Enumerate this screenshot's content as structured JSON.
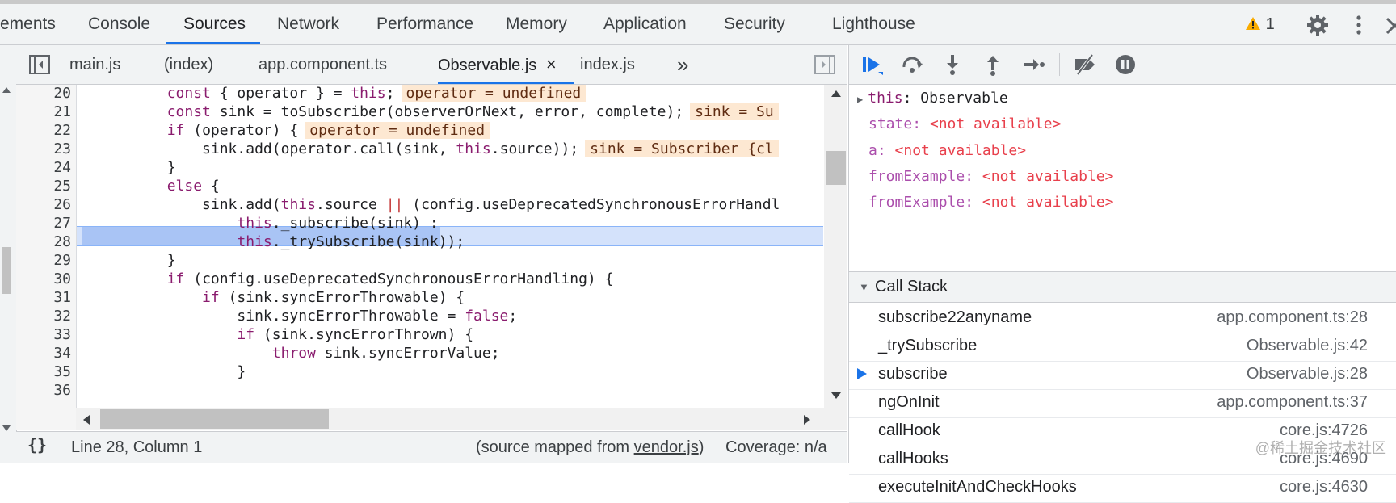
{
  "tabs": [
    "ements",
    "Console",
    "Sources",
    "Network",
    "Performance",
    "Memory",
    "Application",
    "Security",
    "Lighthouse"
  ],
  "active_tab": "Sources",
  "warning_count": "1",
  "file_tabs": [
    "main.js",
    "(index)",
    "app.component.ts",
    "Observable.js",
    "index.js"
  ],
  "active_file": "Observable.js",
  "close_glyph": "×",
  "more_glyph": "»",
  "code_lines": [
    {
      "n": "20",
      "text": "        const { operator } = this;",
      "inline": "operator = undefined"
    },
    {
      "n": "21",
      "text": "        const sink = toSubscriber(observerOrNext, error, complete);",
      "inline": "sink = Su"
    },
    {
      "n": "22",
      "text": "        if (operator) {",
      "inline": "operator = undefined"
    },
    {
      "n": "23",
      "text": "            sink.add(operator.call(sink, this.source));",
      "inline": "sink = Subscriber {cl"
    },
    {
      "n": "24",
      "text": "        }",
      "inline": ""
    },
    {
      "n": "25",
      "text": "        else {",
      "inline": ""
    },
    {
      "n": "26",
      "text": "            sink.add(this.source || (config.useDeprecatedSynchronousErrorHandl",
      "inline": ""
    },
    {
      "n": "27",
      "text": "                this._subscribe(sink) :",
      "inline": ""
    },
    {
      "n": "28",
      "text": "                this._trySubscribe(sink));",
      "inline": ""
    },
    {
      "n": "29",
      "text": "        }",
      "inline": ""
    },
    {
      "n": "30",
      "text": "        if (config.useDeprecatedSynchronousErrorHandling) {",
      "inline": ""
    },
    {
      "n": "31",
      "text": "            if (sink.syncErrorThrowable) {",
      "inline": ""
    },
    {
      "n": "32",
      "text": "                sink.syncErrorThrowable = false;",
      "inline": ""
    },
    {
      "n": "33",
      "text": "                if (sink.syncErrorThrown) {",
      "inline": ""
    },
    {
      "n": "34",
      "text": "                    throw sink.syncErrorValue;",
      "inline": ""
    },
    {
      "n": "35",
      "text": "                }",
      "inline": ""
    },
    {
      "n": "36",
      "text": "",
      "inline": ""
    }
  ],
  "status": {
    "braces": "{}",
    "position": "Line 28, Column 1",
    "mapped_prefix": "(source mapped from ",
    "mapped_file": "vendor.js",
    "mapped_suffix": ")",
    "coverage": "Coverage: n/a"
  },
  "scope": {
    "this_label": "this",
    "this_value": "Observable",
    "items": [
      {
        "name": "state",
        "value": "<not available>"
      },
      {
        "name": "a",
        "value": "<not available>"
      },
      {
        "name": "fromExample",
        "value": "<not available>"
      },
      {
        "name": "fromExample",
        "value": "<not available>"
      }
    ]
  },
  "call_stack": {
    "title": "Call Stack",
    "frames": [
      {
        "name": "subscribe22anyname",
        "loc": "app.component.ts:28",
        "current": false
      },
      {
        "name": "_trySubscribe",
        "loc": "Observable.js:42",
        "current": false
      },
      {
        "name": "subscribe",
        "loc": "Observable.js:28",
        "current": true
      },
      {
        "name": "ngOnInit",
        "loc": "app.component.ts:37",
        "current": false
      },
      {
        "name": "callHook",
        "loc": "core.js:4726",
        "current": false
      },
      {
        "name": "callHooks",
        "loc": "core.js:4690",
        "current": false
      },
      {
        "name": "executeInitAndCheckHooks",
        "loc": "core.js:4630",
        "current": false
      }
    ]
  },
  "watermark": "@稀土掘金技术社区",
  "colors": {
    "accent": "#1a73e8",
    "keyword": "#8a1c6e",
    "warning": "#f9ab00",
    "scope_name": "#ab4eac",
    "scope_value": "#e8404c"
  }
}
